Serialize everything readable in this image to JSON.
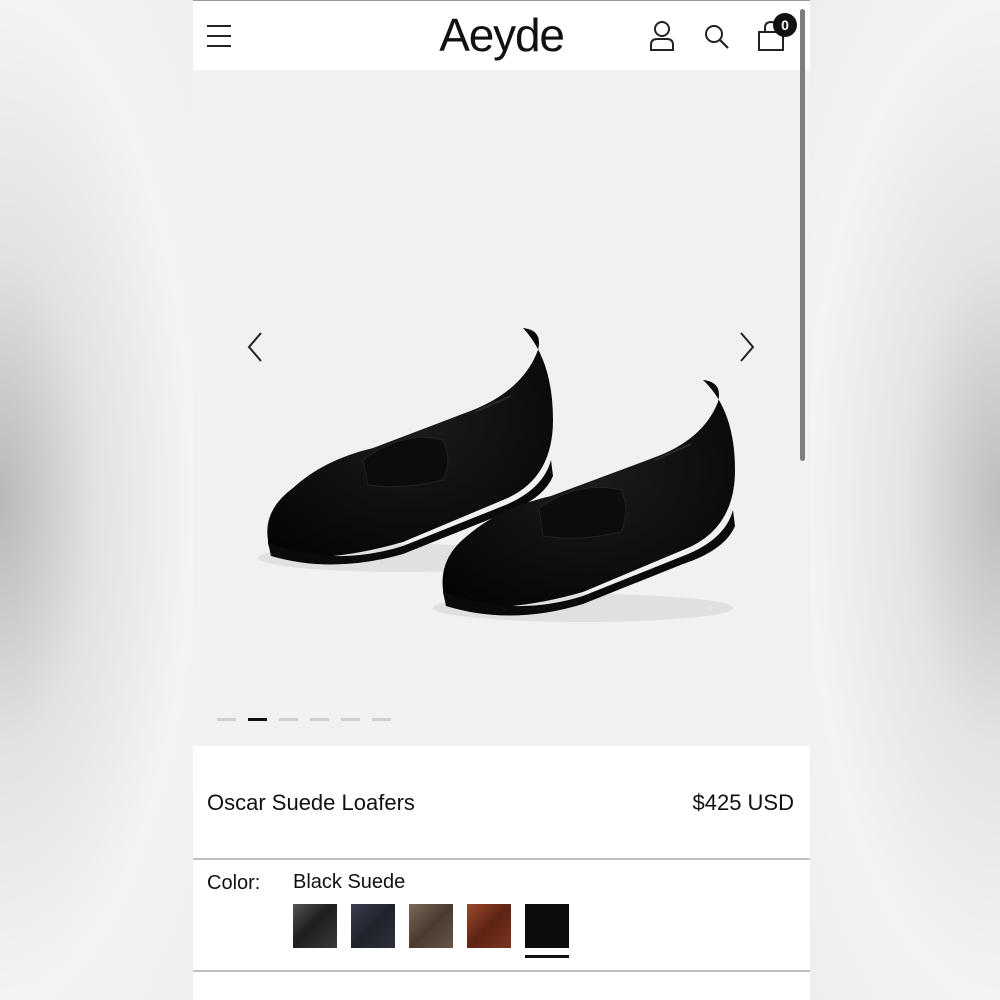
{
  "header": {
    "logo": "Aeyde",
    "cart_count": "0",
    "icons": [
      "hamburger-menu-icon",
      "account-icon",
      "search-icon",
      "shopping-bag-icon"
    ]
  },
  "gallery": {
    "slide_count": 6,
    "active_slide": 2,
    "image_subject": "black suede penny loafers (pair)"
  },
  "product": {
    "name": "Oscar Suede Loafers",
    "price": "$425 USD"
  },
  "color": {
    "label": "Color:",
    "selected": "Black Suede",
    "swatches": [
      {
        "color": "#2b2b2b"
      },
      {
        "color": "#2a2d36"
      },
      {
        "color": "#5b4a3c"
      },
      {
        "color": "#7a3420"
      },
      {
        "color": "#0e0e0e",
        "selected": true
      }
    ]
  }
}
